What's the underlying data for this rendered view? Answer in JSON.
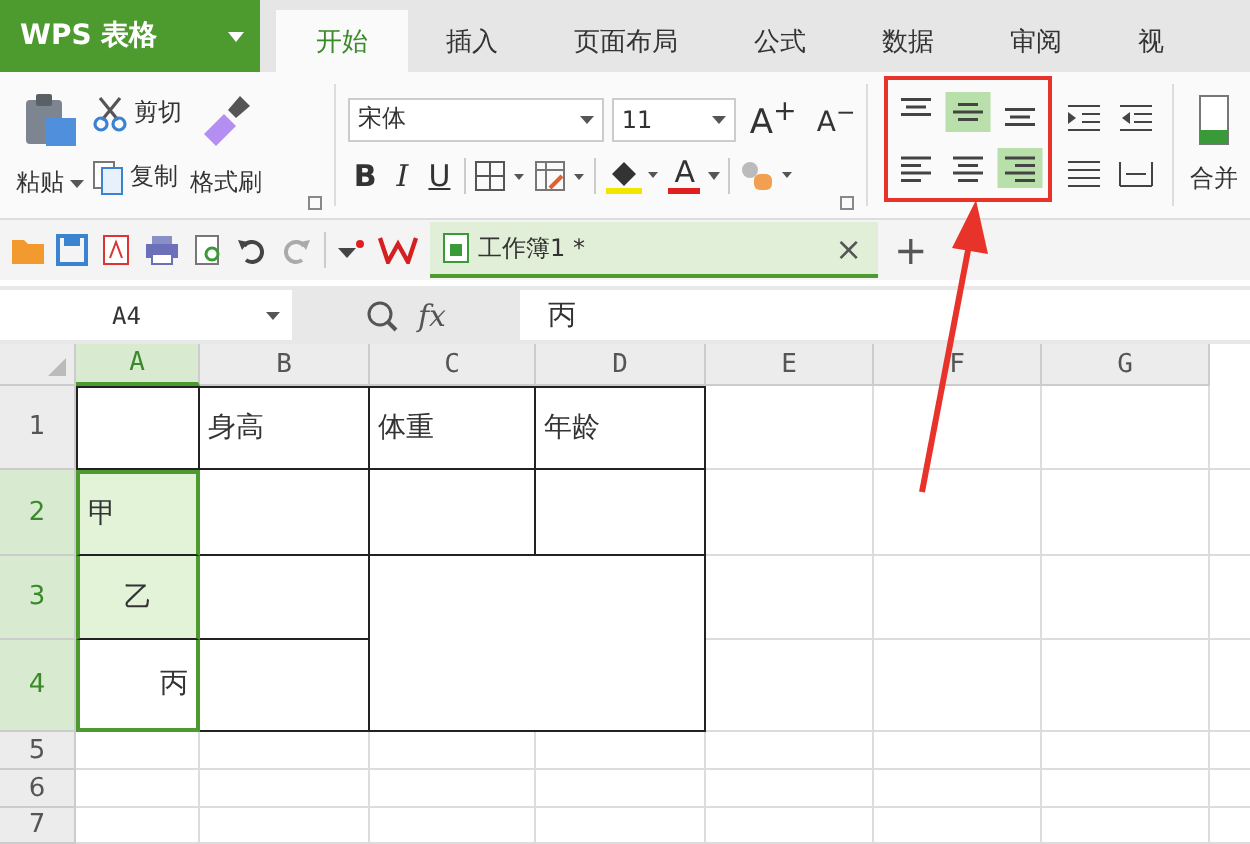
{
  "app": {
    "logo": "WPS 表格"
  },
  "tabs": [
    {
      "label": "开始",
      "selected": true
    },
    {
      "label": "插入",
      "selected": false
    },
    {
      "label": "页面布局",
      "selected": false
    },
    {
      "label": "公式",
      "selected": false
    },
    {
      "label": "数据",
      "selected": false
    },
    {
      "label": "审阅",
      "selected": false
    },
    {
      "label": "视",
      "selected": false
    }
  ],
  "ribbon": {
    "paste": "粘贴",
    "cut": "剪切",
    "copy": "复制",
    "format_painter": "格式刷",
    "font_name": "宋体",
    "font_size": "11",
    "grow_font": "A$^{+}$",
    "shrink_font": "A$^{−}$",
    "bold": "B",
    "italic": "I",
    "underline": "U",
    "font_color": "A",
    "merge": "合并",
    "alignment": [
      {
        "kind": "top",
        "selected": false
      },
      {
        "kind": "middle",
        "selected": true
      },
      {
        "kind": "bottom",
        "selected": false
      },
      {
        "kind": "left",
        "selected": false
      },
      {
        "kind": "center",
        "selected": false
      },
      {
        "kind": "right",
        "selected": true
      }
    ]
  },
  "document_tab": {
    "title": "工作簿1 *",
    "close": "×",
    "new": "+"
  },
  "formula_bar": {
    "name_box": "A4",
    "fx": "fx",
    "value": "丙"
  },
  "columns": [
    {
      "label": "A",
      "selected": true
    },
    {
      "label": "B",
      "selected": false
    },
    {
      "label": "C",
      "selected": false
    },
    {
      "label": "D",
      "selected": false
    },
    {
      "label": "E",
      "selected": false
    },
    {
      "label": "F",
      "selected": false
    },
    {
      "label": "G",
      "selected": false
    }
  ],
  "rows": [
    {
      "label": "1",
      "selected": false,
      "cells": [
        {
          "bordered": true
        },
        {
          "text": "身高",
          "bordered": true
        },
        {
          "text": "体重",
          "bordered": true
        },
        {
          "text": "年龄",
          "bordered": true
        }
      ]
    },
    {
      "label": "2",
      "selected": true,
      "cells": [
        {
          "text": "甲",
          "kind": "left",
          "bordered": true,
          "selected": true
        },
        {
          "bordered": true
        },
        {
          "bordered": true
        },
        {
          "bordered": true
        }
      ]
    },
    {
      "label": "3",
      "selected": true,
      "cells": [
        {
          "text": "乙",
          "kind": "center",
          "bordered": true,
          "selected": true
        },
        {
          "bordered": true
        },
        {
          "kind": "merged",
          "bordered": true
        }
      ]
    },
    {
      "label": "4",
      "selected": true,
      "cells": [
        {
          "text": "丙",
          "kind": "right",
          "bordered": true,
          "selected": true,
          "active": true
        },
        {
          "bordered": true
        }
      ]
    },
    {
      "label": "5",
      "selected": false,
      "cells": []
    },
    {
      "label": "6",
      "selected": false,
      "cells": []
    },
    {
      "label": "7",
      "selected": false,
      "cells": []
    }
  ]
}
